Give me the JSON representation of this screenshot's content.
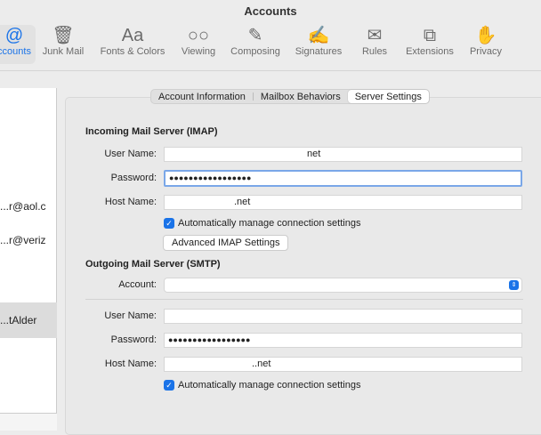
{
  "window": {
    "title": "Accounts"
  },
  "toolbar": [
    {
      "label": "ccounts",
      "icon": "@"
    },
    {
      "label": "Junk Mail",
      "icon": "🗑"
    },
    {
      "label": "Fonts & Colors",
      "icon": "Aa"
    },
    {
      "label": "Viewing",
      "icon": "○○"
    },
    {
      "label": "Composing",
      "icon": "✎"
    },
    {
      "label": "Signatures",
      "icon": "✍"
    },
    {
      "label": "Rules",
      "icon": "✉"
    },
    {
      "label": "Extensions",
      "icon": "⧉"
    },
    {
      "label": "Privacy",
      "icon": "✋"
    }
  ],
  "sidebar": {
    "items": [
      "r@aol.c...",
      "r@veriz...",
      "tAlder..."
    ]
  },
  "tabs": [
    "Account Information",
    "Mailbox Behaviors",
    "Server Settings"
  ],
  "incoming": {
    "heading": "Incoming Mail Server (IMAP)",
    "user_label": "User Name:",
    "user_value": "net",
    "password_label": "Password:",
    "password_value": "●●●●●●●●●●●●●●●●●",
    "host_label": "Host Name:",
    "host_value": ".net",
    "auto_label": "Automatically manage connection settings",
    "advanced_button": "Advanced IMAP Settings"
  },
  "outgoing": {
    "heading": "Outgoing Mail Server (SMTP)",
    "account_label": "Account:",
    "account_value": "",
    "user_label": "User Name:",
    "user_value": "",
    "password_label": "Password:",
    "password_value": "●●●●●●●●●●●●●●●●●",
    "host_label": "Host Name:",
    "host_value": "..net",
    "auto_label": "Automatically manage connection settings"
  }
}
